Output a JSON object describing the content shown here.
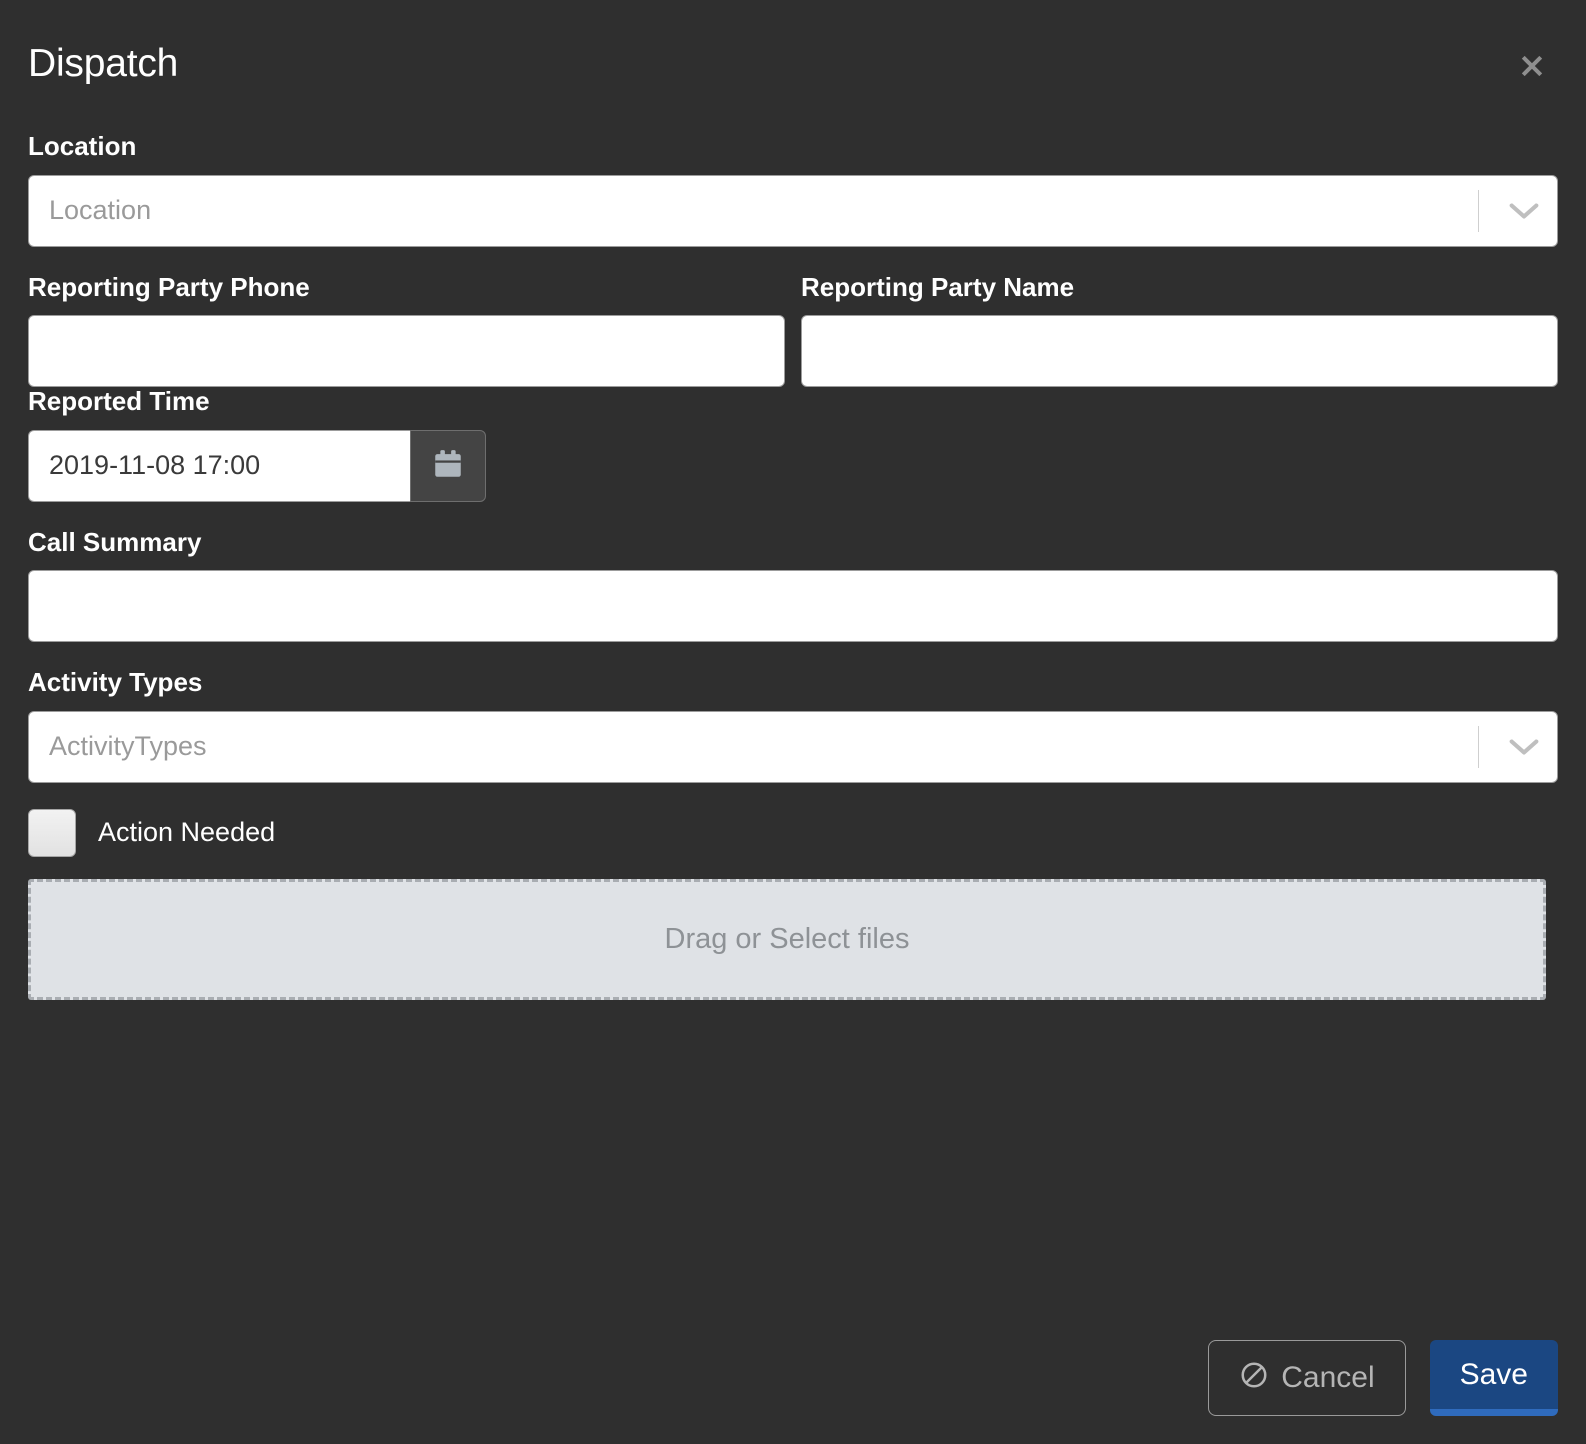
{
  "modal": {
    "title": "Dispatch",
    "close_icon": "close-icon"
  },
  "fields": {
    "location": {
      "label": "Location",
      "placeholder": "Location",
      "value": ""
    },
    "reporting_party_phone": {
      "label": "Reporting Party Phone",
      "placeholder": "",
      "value": ""
    },
    "reporting_party_name": {
      "label": "Reporting Party Name",
      "placeholder": "",
      "value": ""
    },
    "reported_time": {
      "label": "Reported Time",
      "value": "2019-11-08 17:00",
      "calendar_icon": "calendar-icon"
    },
    "call_summary": {
      "label": "Call Summary",
      "placeholder": "",
      "value": ""
    },
    "activity_types": {
      "label": "Activity Types",
      "placeholder": "ActivityTypes",
      "value": ""
    },
    "action_needed": {
      "label": "Action Needed",
      "checked": false
    },
    "attachments": {
      "dropzone_text": "Drag or Select files"
    }
  },
  "footer": {
    "cancel_label": "Cancel",
    "cancel_icon": "ban-icon",
    "save_label": "Save"
  },
  "colors": {
    "background": "#2f2f2f",
    "save_button": "#1b4782",
    "save_button_underline": "#2f6bbd",
    "dropzone_fill": "#dfe2e6",
    "field_border": "#9c9c9c"
  }
}
